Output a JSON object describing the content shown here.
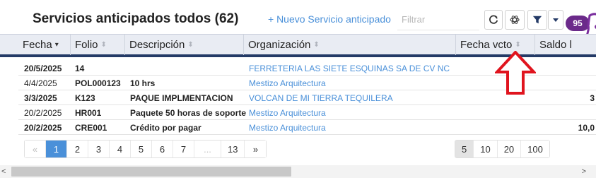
{
  "header": {
    "title": "Servicios anticipados todos (62)",
    "new_button_label": "+ Nuevo Servicio anticipado",
    "filter_placeholder": "Filtrar",
    "badge_count": "95"
  },
  "icons": {
    "refresh": "refresh-icon",
    "gpt": "openai-icon",
    "filter": "funnel-icon",
    "caret": "caret-down-icon"
  },
  "table": {
    "columns": [
      {
        "label": "Fecha",
        "sort": "▾"
      },
      {
        "label": "Folio",
        "sort": "⬍"
      },
      {
        "label": "Descripción",
        "sort": "⬍"
      },
      {
        "label": "Organización",
        "sort": "⬍"
      },
      {
        "label": "Fecha vcto",
        "sort": "⬍"
      },
      {
        "label": "Saldo l",
        "sort": ""
      }
    ],
    "rows": [
      {
        "fecha": "20/5/2025",
        "folio": "14",
        "descripcion": "",
        "organizacion": "FERRETERIA LAS SIETE ESQUINAS SA DE CV NC",
        "saldo": ""
      },
      {
        "fecha": "4/4/2025",
        "folio": "POL000123",
        "descripcion": "10 hrs",
        "organizacion": "Mestizo Arquitectura",
        "saldo": ""
      },
      {
        "fecha": "3/3/2025",
        "folio": "K123",
        "descripcion": "PAQUE IMPLMENTACION",
        "organizacion": "VOLCAN DE MI TIERRA TEQUILERA",
        "saldo": "3"
      },
      {
        "fecha": "20/2/2025",
        "folio": "HR001",
        "descripcion": "Paquete 50 horas de soporte",
        "organizacion": "Mestizo Arquitectura",
        "saldo": ""
      },
      {
        "fecha": "20/2/2025",
        "folio": "CRE001",
        "descripcion": "Crédito por pagar",
        "organizacion": "Mestizo Arquitectura",
        "saldo": "10,0"
      }
    ]
  },
  "pagination": {
    "prev": "«",
    "pages": [
      "1",
      "2",
      "3",
      "4",
      "5",
      "6",
      "7"
    ],
    "ellipsis": "...",
    "last": "13",
    "next": "»",
    "active_page": "1"
  },
  "page_sizes": {
    "options": [
      "5",
      "10",
      "20",
      "100"
    ],
    "active": "5"
  },
  "scrollbar": {
    "left_arrow": "<",
    "right_arrow": ">"
  },
  "colors": {
    "accent": "#4a90d9",
    "header_bar": "#243a66",
    "badge": "#6b2a8a",
    "annotation_arrow": "#e0141e"
  }
}
